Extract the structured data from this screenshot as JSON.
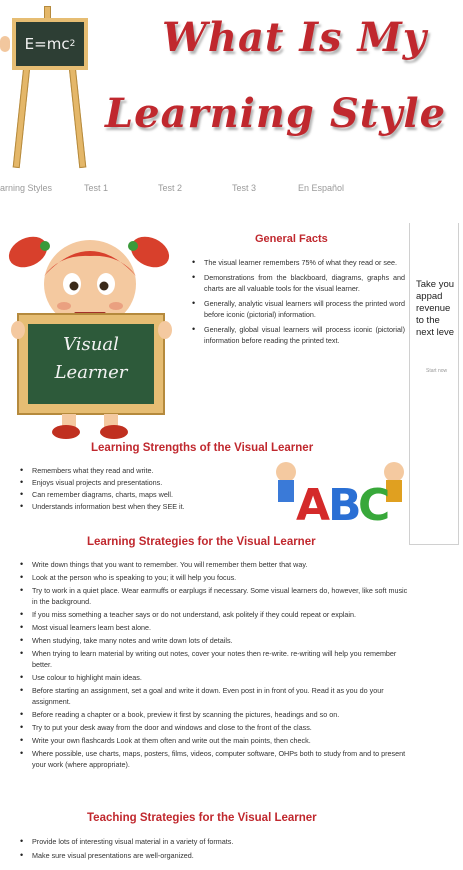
{
  "header": {
    "title_line1": "What Is My",
    "title_line2": "Learning Style ?",
    "chalkboard_text": "E=mc",
    "chalkboard_sup": "2"
  },
  "nav": {
    "items": [
      "arning Styles",
      "Test 1",
      "Test 2",
      "Test 3",
      "En Español"
    ]
  },
  "sidebar": {
    "ad_text": "Take you\nappad\nrevenue\nto the\nnext leve",
    "button_label": "Start now"
  },
  "illustration": {
    "board_line1": "Visual",
    "board_line2": "Learner"
  },
  "general_facts": {
    "title": "General Facts",
    "items": [
      "The visual learner remembers 75% of what they read or see.",
      "Demonstrations from the blackboard, diagrams, graphs and charts are all valuable tools for the visual learner.",
      "Generally, analytic visual learners will process the printed word before iconic (pictorial) information.",
      "Generally, global visual learners will process iconic (pictorial) information before reading the printed text."
    ]
  },
  "strengths": {
    "title": "Learning Strengths of the Visual Learner",
    "items": [
      "Remembers what they read and write.",
      "Enjoys visual projects and presentations.",
      "Can remember diagrams, charts, maps well.",
      "Understands information best when they SEE it."
    ]
  },
  "strategies": {
    "title": "Learning Strategies for the Visual Learner",
    "items": [
      "Write down things that you want to remember. You will remember them better that way.",
      "Look at the person who is speaking to you; it will help you focus.",
      "Try to work in a quiet place. Wear earmuffs or earplugs if necessary. Some visual learners do, however, like soft music in the background.",
      "If you miss something a teacher says or do not understand, ask politely if they could repeat or explain.",
      "Most visual learners learn best alone.",
      "When studying, take many notes and write down lots of details.",
      "When trying to learn material by writing out notes, cover your notes then re-write. re-writing will help you remember better.",
      "Use colour to highlight main ideas.",
      "Before starting an assignment, set a goal and write it down. Even post in in front of you. Read it as you do your assignment.",
      "Before reading a chapter or a book, preview it first by scanning the pictures, headings and so on.",
      "Try to put your desk away from the door and windows and close to the front of the class.",
      "Write your own flashcards Look at them often and write out the main points, then check.",
      "Where possible, use charts, maps, posters, films, videos, computer software, OHPs both to study from and to present your work (where appropriate)."
    ]
  },
  "teaching": {
    "title": "Teaching Strategies for the Visual Learner",
    "items": [
      "Provide lots of interesting visual material in a variety of formats.",
      "Make sure visual presentations are well-organized."
    ]
  },
  "abc_image": {
    "letters": [
      "A",
      "B",
      "C"
    ],
    "colors": [
      "#d42a2a",
      "#2a6fd4",
      "#38a83a"
    ]
  }
}
